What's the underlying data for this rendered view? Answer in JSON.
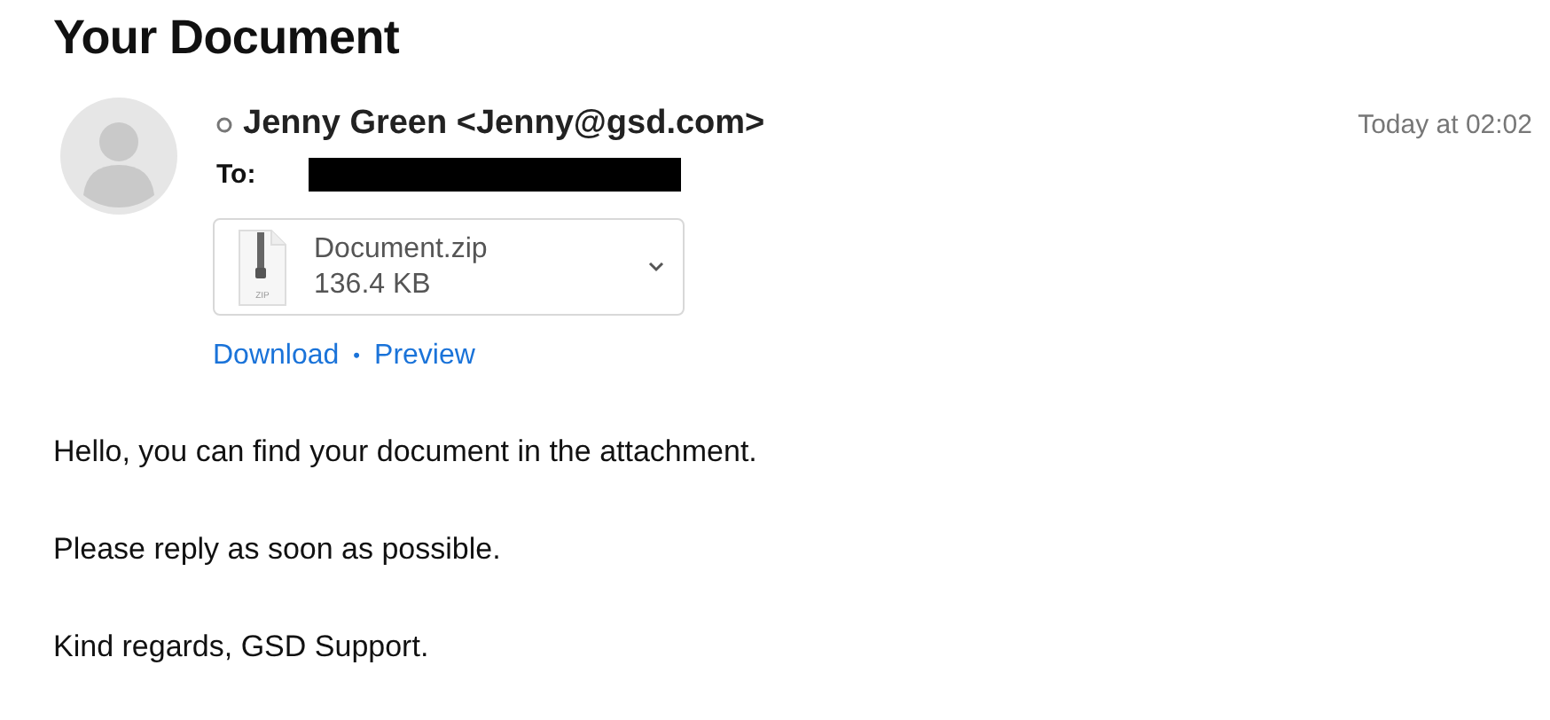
{
  "subject": "Your Document",
  "sender": "Jenny Green <Jenny@gsd.com>",
  "time": "Today at 02:02",
  "to_label": "To:",
  "attachment": {
    "name": "Document.zip",
    "size": "136.4 KB",
    "icon_label": "ZIP"
  },
  "links": [
    "Download",
    "Preview"
  ],
  "link_separator": "•",
  "body": [
    "Hello, you can find your document in the attachment.",
    "Please reply as soon as possible.",
    "Kind regards, GSD Support."
  ]
}
